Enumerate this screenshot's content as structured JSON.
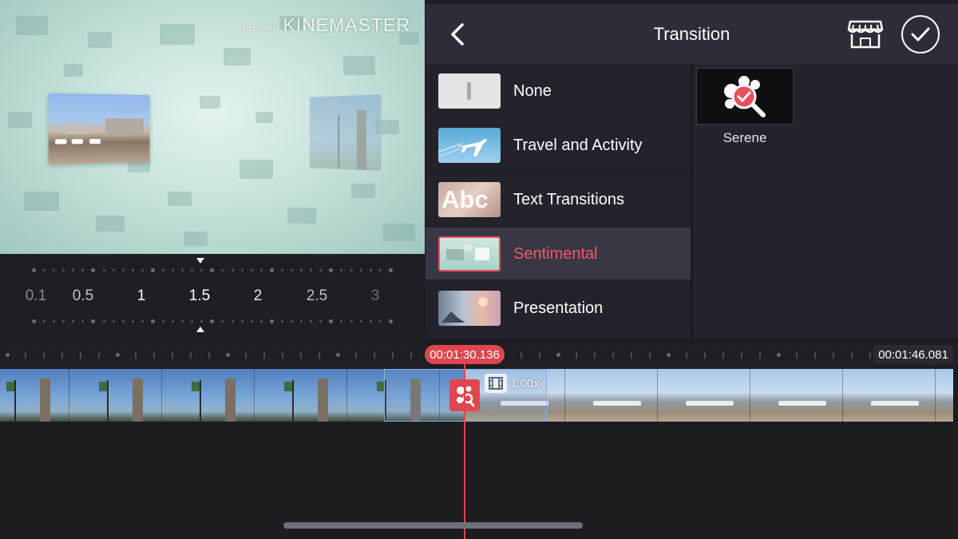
{
  "preview": {
    "watermark_small": "Made with",
    "watermark_big": "KINEMASTER"
  },
  "speed_scale": {
    "labels": [
      "0.1",
      "0.5",
      "1",
      "1.5",
      "2",
      "2.5",
      "3"
    ],
    "selected": "1.5"
  },
  "panel": {
    "title": "Transition",
    "categories": [
      {
        "label": "None"
      },
      {
        "label": "Travel and Activity"
      },
      {
        "label": "Text Transitions"
      },
      {
        "label": "Sentimental"
      },
      {
        "label": "Presentation"
      }
    ],
    "selected_category": "Sentimental",
    "thumb_text": "Abc",
    "effects": [
      {
        "label": "Serene",
        "icon": "serene-effect-icon"
      }
    ]
  },
  "timeline": {
    "current_time": "00:01:30.136",
    "end_time": "00:01:46.081",
    "clip_speed": "1.00x"
  },
  "colors": {
    "accent": "#e0464f",
    "panel_bg": "#2a2833",
    "selected_text": "#f05a63"
  }
}
